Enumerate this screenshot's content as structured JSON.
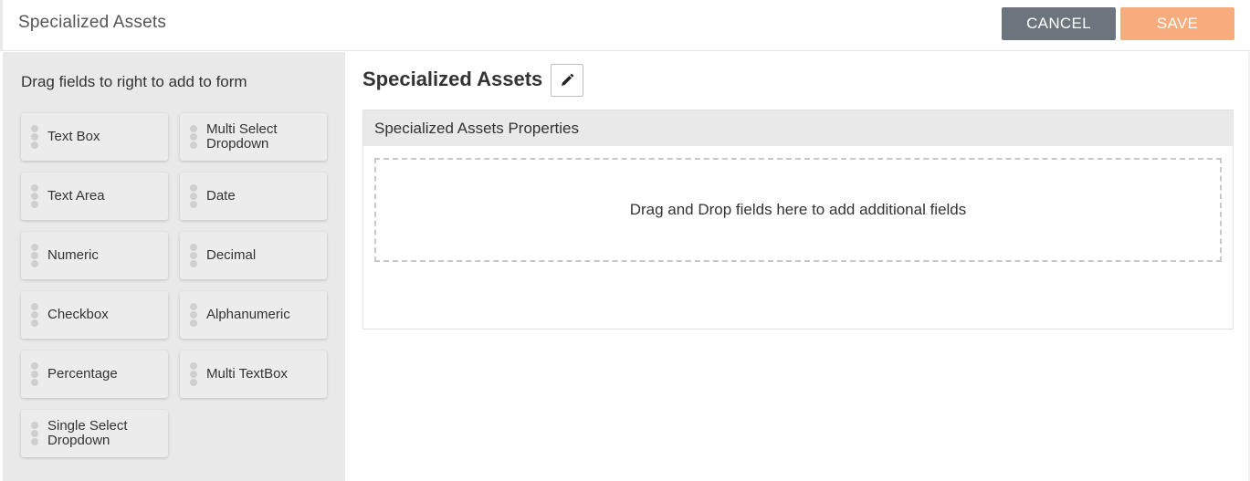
{
  "header": {
    "title": "Specialized Assets",
    "cancel_label": "CANCEL",
    "save_label": "SAVE",
    "colors": {
      "cancel": "#6c757d",
      "save": "#f8ab7c"
    }
  },
  "palette": {
    "instruction": "Drag fields to right to add to form",
    "fields": [
      {
        "label": "Text Box"
      },
      {
        "label": "Multi Select Dropdown"
      },
      {
        "label": "Text Area"
      },
      {
        "label": "Date"
      },
      {
        "label": "Numeric"
      },
      {
        "label": "Decimal"
      },
      {
        "label": "Checkbox"
      },
      {
        "label": "Alphanumeric"
      },
      {
        "label": "Percentage"
      },
      {
        "label": "Multi TextBox"
      },
      {
        "label": "Single Select Dropdown"
      }
    ]
  },
  "form": {
    "title": "Specialized Assets",
    "edit_icon": "pencil-icon",
    "section_title": "Specialized Assets Properties",
    "dropzone_text": "Drag and Drop fields here to add additional fields"
  }
}
